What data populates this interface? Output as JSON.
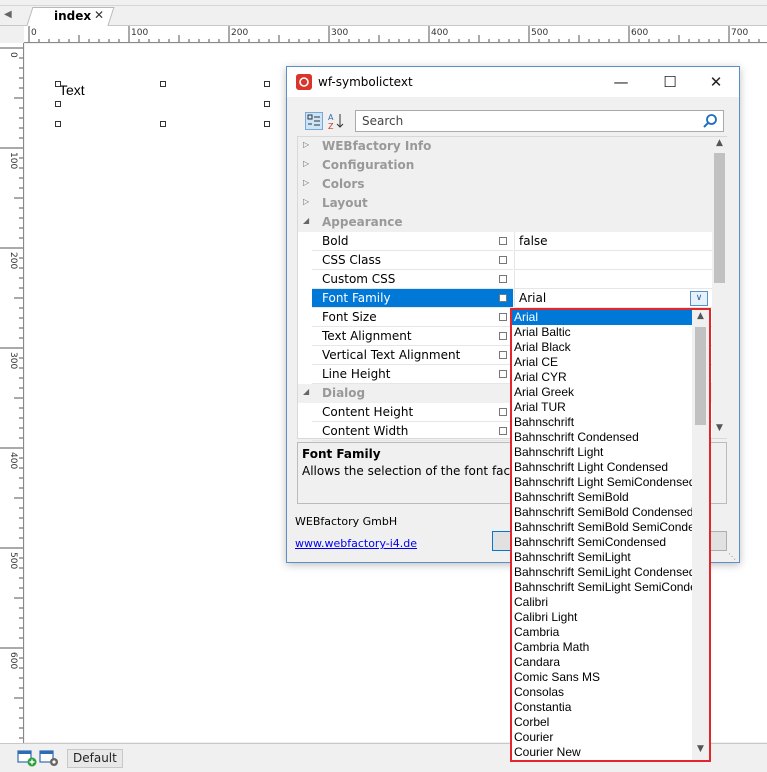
{
  "document_tab": {
    "label": "index"
  },
  "ruler": {
    "h_labels": [
      "0",
      "100",
      "200",
      "300",
      "400",
      "500",
      "600",
      "700"
    ],
    "v_labels": [
      "0",
      "100",
      "200",
      "300",
      "400",
      "500",
      "600"
    ]
  },
  "canvas": {
    "text": "Text"
  },
  "bottom_bar": {
    "layer_label": "Default"
  },
  "dialog": {
    "title": "wf-symbolictext",
    "search_placeholder": "Search",
    "rows": [
      {
        "type": "cat",
        "label": "WEBfactory Info",
        "expanded": false
      },
      {
        "type": "cat",
        "label": "Configuration",
        "expanded": false
      },
      {
        "type": "cat",
        "label": "Colors",
        "expanded": false
      },
      {
        "type": "cat",
        "label": "Layout",
        "expanded": false
      },
      {
        "type": "cat",
        "label": "Appearance",
        "expanded": true
      },
      {
        "type": "prop",
        "name": "Bold",
        "value": "false"
      },
      {
        "type": "prop",
        "name": "CSS Class",
        "value": ""
      },
      {
        "type": "prop",
        "name": "Custom CSS",
        "value": ""
      },
      {
        "type": "prop",
        "name": "Font Family",
        "value": "Arial",
        "selected": true
      },
      {
        "type": "prop",
        "name": "Font Size",
        "value": ""
      },
      {
        "type": "prop",
        "name": "Text Alignment",
        "value": ""
      },
      {
        "type": "prop",
        "name": "Vertical Text Alignment",
        "value": ""
      },
      {
        "type": "prop",
        "name": "Line Height",
        "value": ""
      },
      {
        "type": "cat",
        "label": "Dialog",
        "expanded": true
      },
      {
        "type": "prop",
        "name": "Content Height",
        "value": ""
      },
      {
        "type": "prop",
        "name": "Content Width",
        "value": ""
      }
    ],
    "description": {
      "title": "Font Family",
      "text": "Allows the selection of the font face."
    },
    "company": "WEBfactory GmbH",
    "link": "www.webfactory-i4.de"
  },
  "font_dropdown": {
    "selected": "Arial",
    "options": [
      "Arial",
      "Arial Baltic",
      "Arial Black",
      "Arial CE",
      "Arial CYR",
      "Arial Greek",
      "Arial TUR",
      "Bahnschrift",
      "Bahnschrift Condensed",
      "Bahnschrift Light",
      "Bahnschrift Light Condensed",
      "Bahnschrift Light SemiCondensed",
      "Bahnschrift SemiBold",
      "Bahnschrift SemiBold Condensed",
      "Bahnschrift SemiBold SemiConde",
      "Bahnschrift SemiCondensed",
      "Bahnschrift SemiLight",
      "Bahnschrift SemiLight Condensed",
      "Bahnschrift SemiLight SemiConde",
      "Calibri",
      "Calibri Light",
      "Cambria",
      "Cambria Math",
      "Candara",
      "Comic Sans MS",
      "Consolas",
      "Constantia",
      "Corbel",
      "Courier",
      "Courier New"
    ]
  },
  "colors": {
    "accent": "#0078d7",
    "highlight_border": "#e3262c",
    "title_icon": "#d9352b",
    "link": "#0000ee"
  }
}
